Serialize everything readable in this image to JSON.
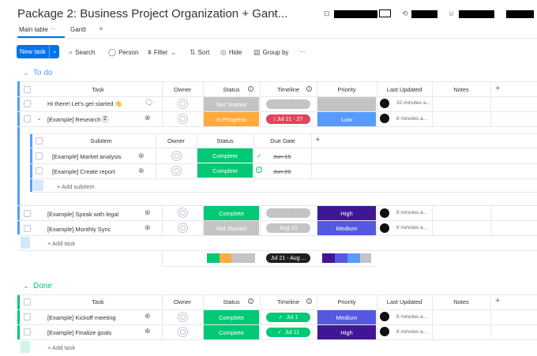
{
  "header": {
    "title": "Package 2: Business Project Organization + Gant...",
    "colors": {
      "accent": "#0073ea",
      "redaction": "#000000"
    }
  },
  "views": {
    "tabs": [
      "Main table",
      "Gantt"
    ],
    "more": "···",
    "add": "+"
  },
  "toolbar": {
    "new_task": "New task",
    "search": "Search",
    "person": "Person",
    "filter": "Filter",
    "sort": "Sort",
    "hide": "Hide",
    "group_by": "Group by",
    "more": "···"
  },
  "columns": {
    "task": "Task",
    "owner": "Owner",
    "status": "Status",
    "timeline": "Timeline",
    "priority": "Priority",
    "last_updated": "Last Updated",
    "notes": "Notes"
  },
  "todo": {
    "title": "To do",
    "color": "#579bfc",
    "rows": [
      {
        "task": "Hi there! Let's get started 👋",
        "status": "Not Started",
        "timeline": "-",
        "priority": "",
        "updated": "32 minutes a..."
      },
      {
        "task": "[Example] Research",
        "subcount": "2",
        "status": "In Progress",
        "timeline": "! Jul 21 - 27",
        "priority": "Low",
        "updated": "8 minutes a..."
      },
      {
        "task": "[Example] Speak with legal",
        "status": "Complete",
        "timeline": "-",
        "priority": "High",
        "updated": "8 minutes a..."
      },
      {
        "task": "[Example] Monthly Sync",
        "status": "Not Started",
        "timeline": "Aug 10",
        "priority": "Medium",
        "updated": "6 minutes a..."
      }
    ],
    "subitems": {
      "headers": {
        "subitem": "Subitem",
        "owner": "Owner",
        "status": "Status",
        "due": "Due Date"
      },
      "rows": [
        {
          "name": "[Example] Market analysis",
          "status": "Complete",
          "due": "Jun 15"
        },
        {
          "name": "[Example] Create report",
          "status": "Complete",
          "due": "Jun 20"
        }
      ],
      "add": "+ Add subitem"
    },
    "add": "+ Add task",
    "summary_timeline": "Jul 21 - Aug ..."
  },
  "done": {
    "title": "Done",
    "color": "#00c875",
    "rows": [
      {
        "task": "[Example] Kickoff meeting",
        "status": "Complete",
        "timeline": "Jul 1",
        "priority": "Medium",
        "updated": "8 minutes a..."
      },
      {
        "task": "[Example] Finalize goals",
        "status": "Complete",
        "timeline": "Jul 11",
        "priority": "High",
        "updated": "8 minutes a..."
      }
    ],
    "add": "+ Add task"
  },
  "status_colors": {
    "Not Started": "#c4c4c4",
    "In Progress": "#fdab3d",
    "Complete": "#00c875"
  },
  "priority_colors": {
    "Low": "#579bfc",
    "Medium": "#5559df",
    "High": "#401694",
    "empty": "#c4c4c4"
  }
}
